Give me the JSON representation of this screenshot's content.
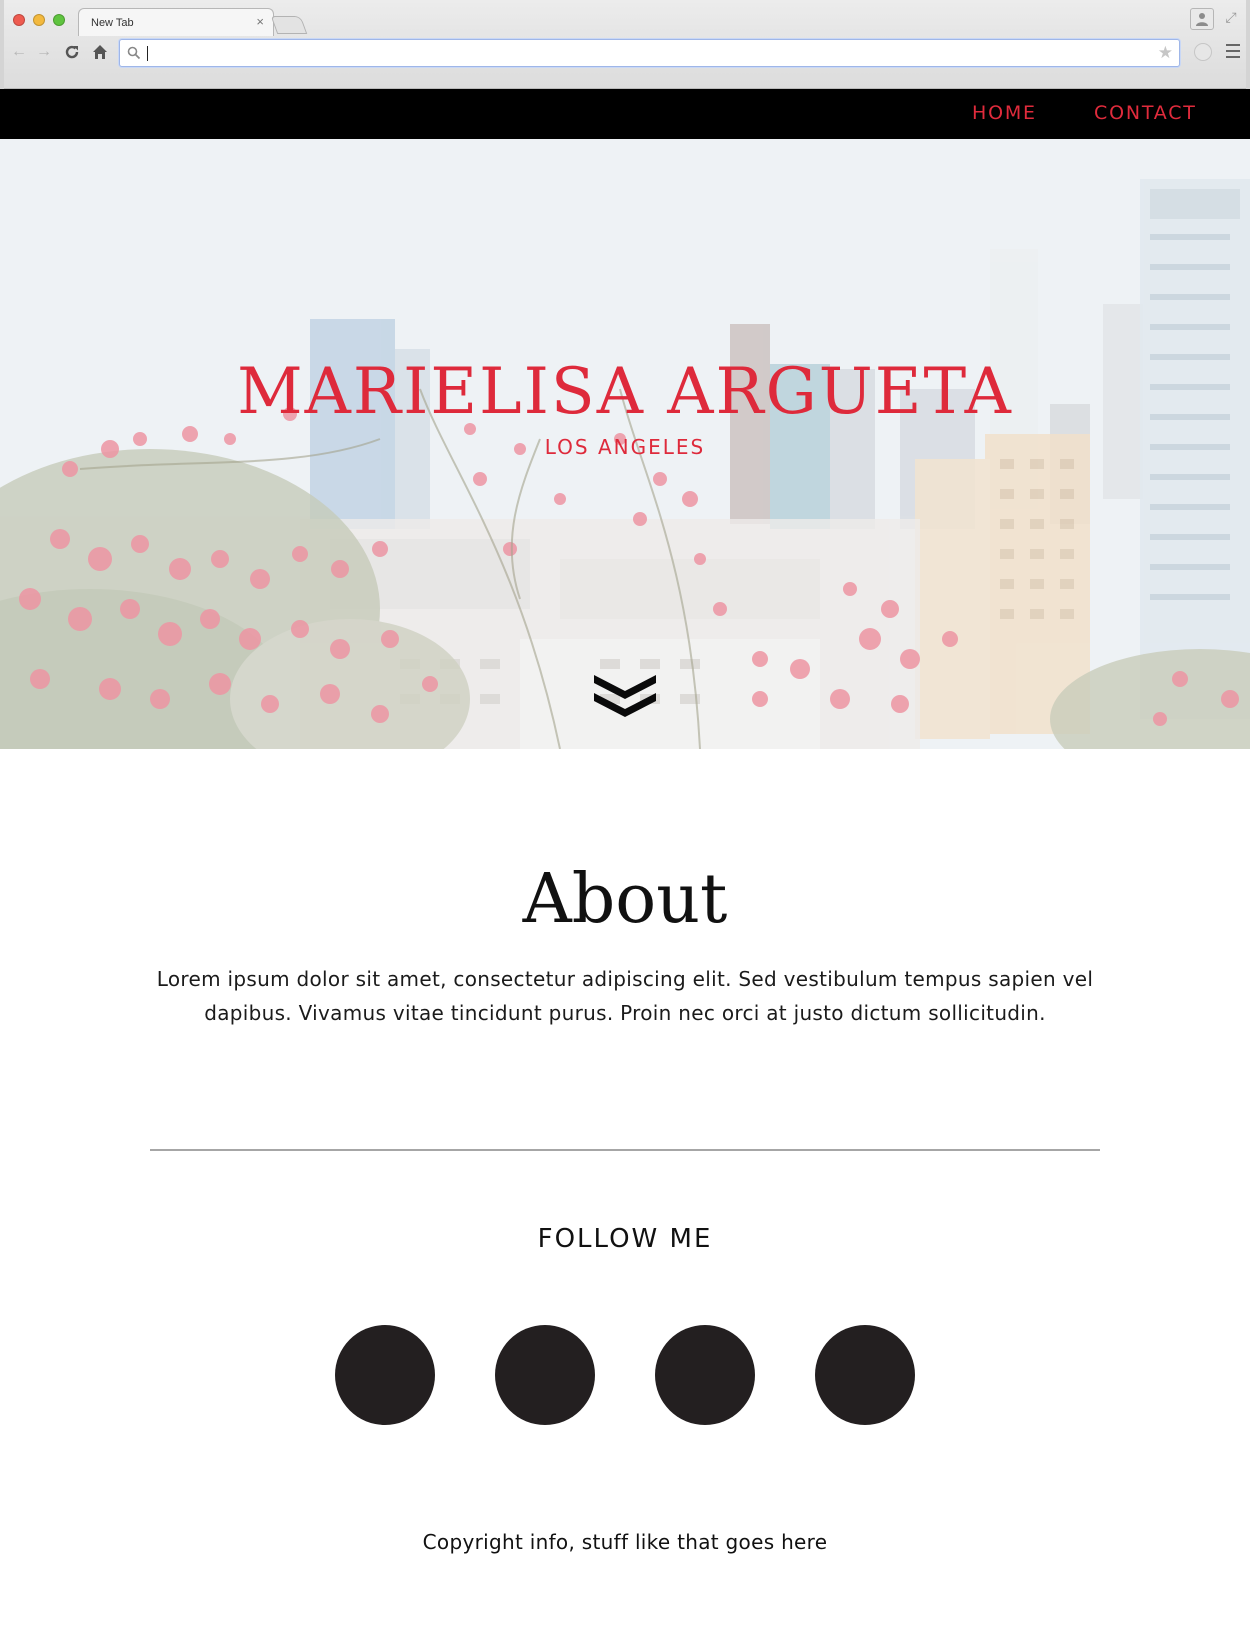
{
  "browser": {
    "tab_title": "New Tab",
    "tab_close_icon": "close-icon",
    "address_value": "",
    "icons": {
      "back": "back-arrow-icon",
      "forward": "forward-arrow-icon",
      "reload": "reload-icon",
      "home": "home-icon",
      "search": "search-icon",
      "bookmark": "star-icon",
      "menu": "hamburger-menu-icon",
      "profile": "user-profile-icon",
      "fullscreen": "fullscreen-icon"
    }
  },
  "nav": {
    "items": [
      {
        "label": "HOME"
      },
      {
        "label": "CONTACT"
      }
    ]
  },
  "hero": {
    "title": "MARIELISA ARGUETA",
    "subtitle": "LOS ANGELES",
    "scroll_icon": "double-chevron-down-icon"
  },
  "about": {
    "heading": "About",
    "body": "Lorem ipsum dolor sit amet, consectetur adipiscing elit. Sed vestibulum tempus sapien vel dapibus. Vivamus vitae tincidunt purus. Proin nec orci at justo dictum sollicitudin."
  },
  "follow": {
    "heading": "FOLLOW ME",
    "icons": [
      "social-icon-1",
      "social-icon-2",
      "social-icon-3",
      "social-icon-4"
    ]
  },
  "footer": {
    "copyright": "Copyright info, stuff like that goes here"
  },
  "colors": {
    "accent": "#de2a3b",
    "nav_bg": "#000000",
    "social": "#231f20",
    "divider": "#a6a6a6"
  }
}
